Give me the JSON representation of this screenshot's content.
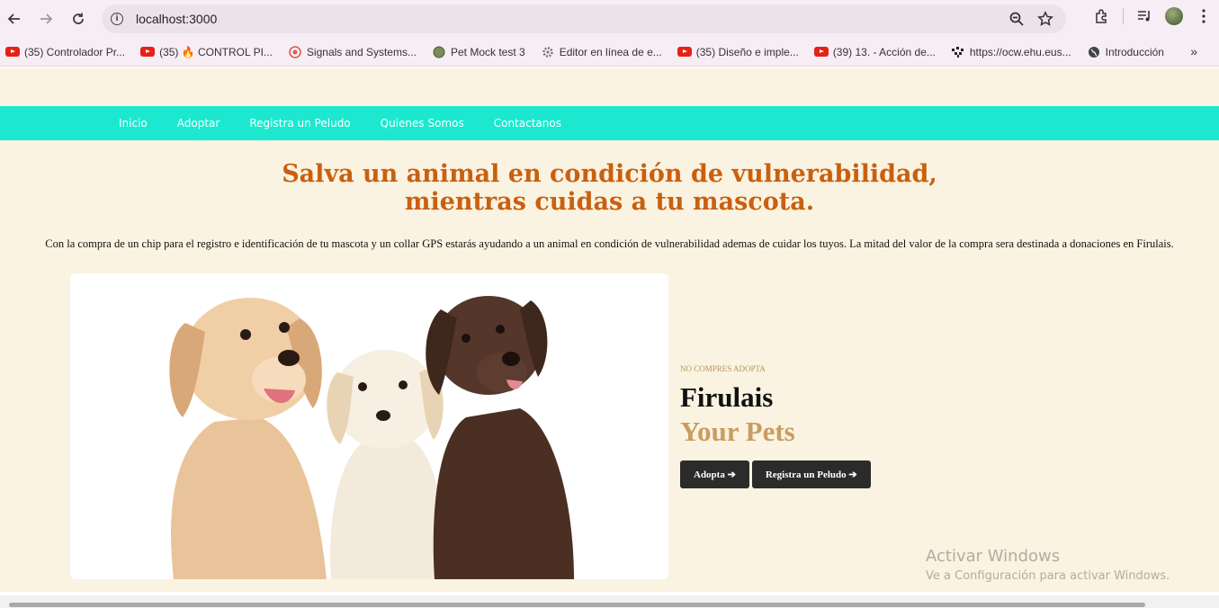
{
  "browser": {
    "url": "localhost:3000",
    "bookmarks": [
      {
        "label": "(35) Controlador Pr...",
        "icon": "youtube-icon"
      },
      {
        "label": "(35) 🔥 CONTROL PI...",
        "icon": "youtube-icon"
      },
      {
        "label": "Signals and Systems...",
        "icon": "target-icon"
      },
      {
        "label": "Pet Mock test 3",
        "icon": "globe-green-icon"
      },
      {
        "label": "Editor en línea de e...",
        "icon": "gear-icon"
      },
      {
        "label": "(35) Diseño e imple...",
        "icon": "youtube-icon"
      },
      {
        "label": "(39) 13. - Acción de...",
        "icon": "youtube-icon"
      },
      {
        "label": "https://ocw.ehu.eus...",
        "icon": "ehu-icon"
      },
      {
        "label": "Introducción",
        "icon": "globe-icon"
      }
    ],
    "bookmarks_more": "»"
  },
  "nav": {
    "items": [
      "Inicio",
      "Adoptar",
      "Registra un Peludo",
      "Quienes Somos",
      "Contactanos"
    ]
  },
  "hero": {
    "title_line1": "Salva un animal en condición de vulnerabilidad,",
    "title_line2": "mientras cuidas a tu mascota.",
    "intro": "Con la compra de un chip para el registro e identificación de tu mascota y un collar GPS estarás ayudando a un animal en condición de vulnerabilidad ademas de cuidar los tuyos. La mitad del valor de la compra sera destinada a donaciones en Firulais."
  },
  "feature": {
    "kicker": "NO COMPRES ADOPTA",
    "brand": "Firulais",
    "brand_sub": "Your Pets",
    "button_adopt": "Adopta ➔",
    "button_register": "Registra un Peludo ➔"
  },
  "watermark": {
    "line1": "Activar Windows",
    "line2": "Ve a Configuración para activar Windows."
  },
  "colors": {
    "nav_bg": "#1be8cf",
    "title": "#c96010",
    "brand_sub": "#c99c61",
    "page_bg": "#faf3e1"
  }
}
